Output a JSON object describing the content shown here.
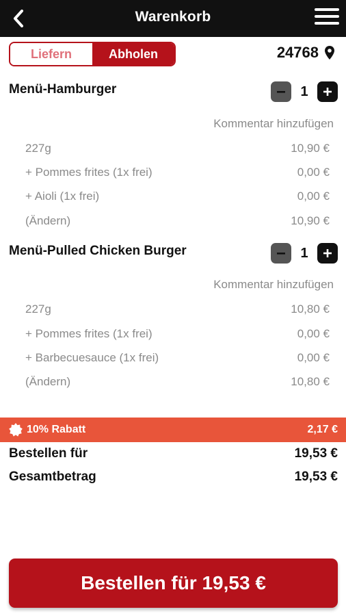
{
  "header": {
    "title": "Warenkorb",
    "back_icon": "back-chevron-icon",
    "menu_icon": "hamburger-menu-icon"
  },
  "mode_toggle": {
    "deliver_label": "Liefern",
    "pickup_label": "Abholen",
    "selected": "Abholen"
  },
  "postal_code": {
    "value": "24768",
    "icon": "location-pin-icon"
  },
  "cart_items": [
    {
      "name": "Menü-Hamburger",
      "quantity": "1",
      "comment_label": "Kommentar hinzufügen",
      "lines": [
        {
          "label": "227g",
          "price": "10,90 €"
        },
        {
          "label": "+ Pommes frites (1x frei)",
          "price": "0,00 €"
        },
        {
          "label": "+ Aioli (1x frei)",
          "price": "0,00 €"
        },
        {
          "label": "(Ändern)",
          "price": "10,90 €"
        }
      ]
    },
    {
      "name": "Menü-Pulled Chicken Burger",
      "quantity": "1",
      "comment_label": "Kommentar hinzufügen",
      "lines": [
        {
          "label": "227g",
          "price": "10,80 €"
        },
        {
          "label": "+ Pommes frites (1x frei)",
          "price": "0,00 €"
        },
        {
          "label": "+ Barbecuesauce (1x frei)",
          "price": "0,00 €"
        },
        {
          "label": "(Ändern)",
          "price": "10,80 €"
        }
      ]
    }
  ],
  "discount": {
    "label": "10% Rabatt",
    "amount": "2,17 €",
    "icon": "badge-star-icon",
    "color": "#e8553a"
  },
  "totals": {
    "order_for_label": "Bestellen für",
    "order_for_value": "19,53 €",
    "total_label": "Gesamtbetrag",
    "total_value": "19,53 €"
  },
  "order_button": {
    "label": "Bestellen für 19,53 €",
    "color": "#b5121b"
  }
}
